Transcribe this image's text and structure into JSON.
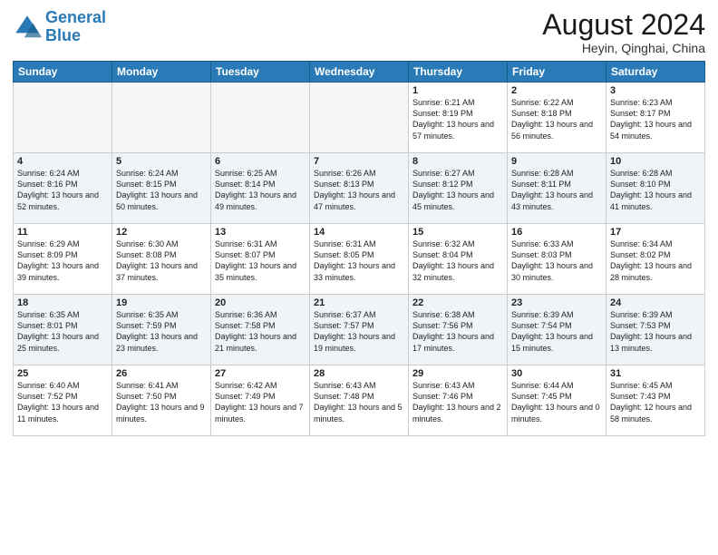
{
  "header": {
    "logo_general": "General",
    "logo_blue": "Blue",
    "month": "August 2024",
    "location": "Heyin, Qinghai, China"
  },
  "days_of_week": [
    "Sunday",
    "Monday",
    "Tuesday",
    "Wednesday",
    "Thursday",
    "Friday",
    "Saturday"
  ],
  "weeks": [
    [
      {
        "day": "",
        "info": ""
      },
      {
        "day": "",
        "info": ""
      },
      {
        "day": "",
        "info": ""
      },
      {
        "day": "",
        "info": ""
      },
      {
        "day": "1",
        "info": "Sunrise: 6:21 AM\nSunset: 8:19 PM\nDaylight: 13 hours and 57 minutes."
      },
      {
        "day": "2",
        "info": "Sunrise: 6:22 AM\nSunset: 8:18 PM\nDaylight: 13 hours and 56 minutes."
      },
      {
        "day": "3",
        "info": "Sunrise: 6:23 AM\nSunset: 8:17 PM\nDaylight: 13 hours and 54 minutes."
      }
    ],
    [
      {
        "day": "4",
        "info": "Sunrise: 6:24 AM\nSunset: 8:16 PM\nDaylight: 13 hours and 52 minutes."
      },
      {
        "day": "5",
        "info": "Sunrise: 6:24 AM\nSunset: 8:15 PM\nDaylight: 13 hours and 50 minutes."
      },
      {
        "day": "6",
        "info": "Sunrise: 6:25 AM\nSunset: 8:14 PM\nDaylight: 13 hours and 49 minutes."
      },
      {
        "day": "7",
        "info": "Sunrise: 6:26 AM\nSunset: 8:13 PM\nDaylight: 13 hours and 47 minutes."
      },
      {
        "day": "8",
        "info": "Sunrise: 6:27 AM\nSunset: 8:12 PM\nDaylight: 13 hours and 45 minutes."
      },
      {
        "day": "9",
        "info": "Sunrise: 6:28 AM\nSunset: 8:11 PM\nDaylight: 13 hours and 43 minutes."
      },
      {
        "day": "10",
        "info": "Sunrise: 6:28 AM\nSunset: 8:10 PM\nDaylight: 13 hours and 41 minutes."
      }
    ],
    [
      {
        "day": "11",
        "info": "Sunrise: 6:29 AM\nSunset: 8:09 PM\nDaylight: 13 hours and 39 minutes."
      },
      {
        "day": "12",
        "info": "Sunrise: 6:30 AM\nSunset: 8:08 PM\nDaylight: 13 hours and 37 minutes."
      },
      {
        "day": "13",
        "info": "Sunrise: 6:31 AM\nSunset: 8:07 PM\nDaylight: 13 hours and 35 minutes."
      },
      {
        "day": "14",
        "info": "Sunrise: 6:31 AM\nSunset: 8:05 PM\nDaylight: 13 hours and 33 minutes."
      },
      {
        "day": "15",
        "info": "Sunrise: 6:32 AM\nSunset: 8:04 PM\nDaylight: 13 hours and 32 minutes."
      },
      {
        "day": "16",
        "info": "Sunrise: 6:33 AM\nSunset: 8:03 PM\nDaylight: 13 hours and 30 minutes."
      },
      {
        "day": "17",
        "info": "Sunrise: 6:34 AM\nSunset: 8:02 PM\nDaylight: 13 hours and 28 minutes."
      }
    ],
    [
      {
        "day": "18",
        "info": "Sunrise: 6:35 AM\nSunset: 8:01 PM\nDaylight: 13 hours and 25 minutes."
      },
      {
        "day": "19",
        "info": "Sunrise: 6:35 AM\nSunset: 7:59 PM\nDaylight: 13 hours and 23 minutes."
      },
      {
        "day": "20",
        "info": "Sunrise: 6:36 AM\nSunset: 7:58 PM\nDaylight: 13 hours and 21 minutes."
      },
      {
        "day": "21",
        "info": "Sunrise: 6:37 AM\nSunset: 7:57 PM\nDaylight: 13 hours and 19 minutes."
      },
      {
        "day": "22",
        "info": "Sunrise: 6:38 AM\nSunset: 7:56 PM\nDaylight: 13 hours and 17 minutes."
      },
      {
        "day": "23",
        "info": "Sunrise: 6:39 AM\nSunset: 7:54 PM\nDaylight: 13 hours and 15 minutes."
      },
      {
        "day": "24",
        "info": "Sunrise: 6:39 AM\nSunset: 7:53 PM\nDaylight: 13 hours and 13 minutes."
      }
    ],
    [
      {
        "day": "25",
        "info": "Sunrise: 6:40 AM\nSunset: 7:52 PM\nDaylight: 13 hours and 11 minutes."
      },
      {
        "day": "26",
        "info": "Sunrise: 6:41 AM\nSunset: 7:50 PM\nDaylight: 13 hours and 9 minutes."
      },
      {
        "day": "27",
        "info": "Sunrise: 6:42 AM\nSunset: 7:49 PM\nDaylight: 13 hours and 7 minutes."
      },
      {
        "day": "28",
        "info": "Sunrise: 6:43 AM\nSunset: 7:48 PM\nDaylight: 13 hours and 5 minutes."
      },
      {
        "day": "29",
        "info": "Sunrise: 6:43 AM\nSunset: 7:46 PM\nDaylight: 13 hours and 2 minutes."
      },
      {
        "day": "30",
        "info": "Sunrise: 6:44 AM\nSunset: 7:45 PM\nDaylight: 13 hours and 0 minutes."
      },
      {
        "day": "31",
        "info": "Sunrise: 6:45 AM\nSunset: 7:43 PM\nDaylight: 12 hours and 58 minutes."
      }
    ]
  ]
}
